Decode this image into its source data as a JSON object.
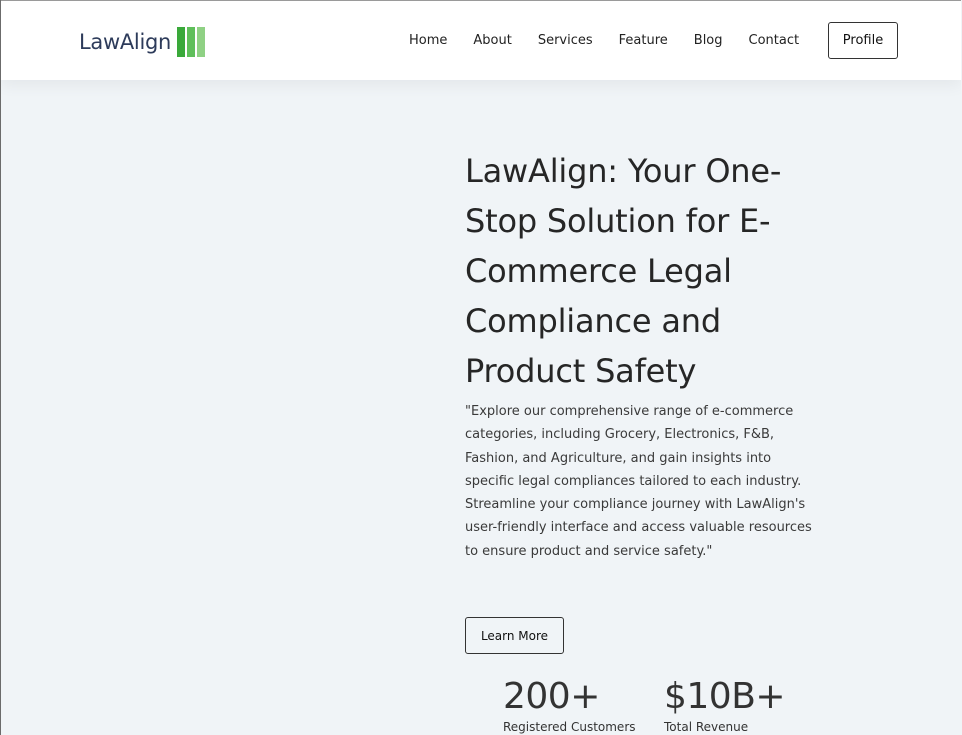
{
  "header": {
    "logo_text": "LawAlign",
    "logo_colors": [
      "#3aa93a",
      "#5fbf5a",
      "#8fd184"
    ],
    "nav": [
      {
        "label": "Home"
      },
      {
        "label": "About"
      },
      {
        "label": "Services"
      },
      {
        "label": "Feature"
      },
      {
        "label": "Blog"
      },
      {
        "label": "Contact"
      }
    ],
    "profile_label": "Profile"
  },
  "hero": {
    "title": "LawAlign: Your One-Stop Solution for E-Commerce Legal Compliance and Product Safety",
    "description": " \"Explore our comprehensive range of e-commerce categories, including Grocery, Electronics, F&B, Fashion, and Agriculture, and gain insights into specific legal compliances tailored to each industry. Streamline your compliance journey with LawAlign's user-friendly interface and access valuable resources to ensure product and service safety.\"",
    "cta_label": "Learn More"
  },
  "stats": [
    {
      "value": "200+",
      "label": "Registered Customers"
    },
    {
      "value": "$10B+",
      "label": "Total Revenue"
    }
  ],
  "colors": {
    "page_background": "#f0f4f7",
    "header_background": "#ffffff",
    "text": "#262626"
  }
}
